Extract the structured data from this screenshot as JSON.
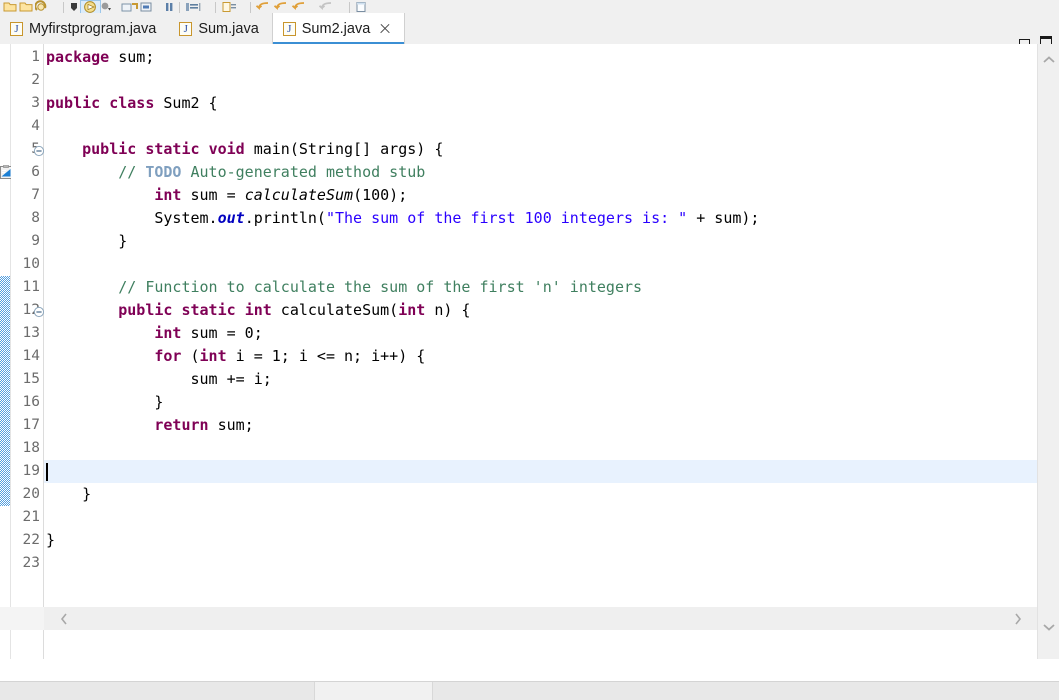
{
  "window": {
    "minimize_label": "Minimize",
    "maximize_label": "Maximize"
  },
  "toolbar": {
    "icons": [
      {
        "name": "new-java-project-icon",
        "glyph": "folder-yellow"
      },
      {
        "name": "new-folder-icon",
        "glyph": "folder-yellow"
      },
      {
        "name": "save-icon",
        "glyph": "save-disk"
      },
      {
        "name": "debug-icon",
        "glyph": "bug-black"
      },
      {
        "name": "run-icon",
        "glyph": "run-green-active",
        "active": true
      },
      {
        "name": "run-dropdown-icon",
        "glyph": "chevron-down"
      },
      {
        "name": "external-tools-icon",
        "glyph": "tools"
      },
      {
        "name": "new-class-icon",
        "glyph": "class-box"
      },
      {
        "name": "pause-icon",
        "glyph": "pause-bars"
      },
      {
        "name": "toggle-breakpoint-icon",
        "glyph": "breakpoint"
      },
      {
        "name": "open-type-icon",
        "glyph": "type-box"
      },
      {
        "name": "back-navigation-icon",
        "glyph": "arrow-back"
      },
      {
        "name": "forward-navigation-icon",
        "glyph": "arrow-forward"
      },
      {
        "name": "next-annotation-icon",
        "glyph": "arrow-next"
      },
      {
        "name": "previous-annotation-icon",
        "glyph": "arrow-prev"
      },
      {
        "name": "new-window-icon",
        "glyph": "window-box"
      }
    ]
  },
  "tabs": [
    {
      "label": "Myfirstprogram.java",
      "active": false,
      "closable": false
    },
    {
      "label": "Sum.java",
      "active": false,
      "closable": false
    },
    {
      "label": "Sum2.java",
      "active": true,
      "closable": true
    }
  ],
  "editor": {
    "active_file": "Sum2.java",
    "current_line": 19,
    "first_line_number": 1,
    "last_line_number": 23,
    "change_bar_start_line": 11,
    "change_bar_end_line": 20,
    "todo_marker_line": 6,
    "fold_marker_lines": [
      5,
      12
    ],
    "colors": {
      "keyword": "#7f0055",
      "string": "#2a00ff",
      "comment": "#3f7f5f",
      "todo_tag": "#7f9fbf",
      "static_field": "#0000c0",
      "line_number": "#6c6c6c",
      "current_line_highlight": "#e8f2fe",
      "tab_active_underline": "#3b8fd4",
      "change_bar": "#1a7fd4"
    },
    "lines": [
      {
        "n": 1,
        "tokens": [
          {
            "t": "package",
            "c": "kw"
          },
          {
            "t": " sum;",
            "c": "plain"
          }
        ]
      },
      {
        "n": 2,
        "tokens": []
      },
      {
        "n": 3,
        "tokens": [
          {
            "t": "public",
            "c": "kw"
          },
          {
            "t": " ",
            "c": "plain"
          },
          {
            "t": "class",
            "c": "kw"
          },
          {
            "t": " Sum2 {",
            "c": "plain"
          }
        ]
      },
      {
        "n": 4,
        "tokens": []
      },
      {
        "n": 5,
        "tokens": [
          {
            "t": "    ",
            "c": "plain"
          },
          {
            "t": "public",
            "c": "kw"
          },
          {
            "t": " ",
            "c": "plain"
          },
          {
            "t": "static",
            "c": "kw"
          },
          {
            "t": " ",
            "c": "plain"
          },
          {
            "t": "void",
            "c": "kw"
          },
          {
            "t": " main(String[] args) {",
            "c": "plain"
          }
        ]
      },
      {
        "n": 6,
        "tokens": [
          {
            "t": "        ",
            "c": "plain"
          },
          {
            "t": "// ",
            "c": "cmt"
          },
          {
            "t": "TODO",
            "c": "todo"
          },
          {
            "t": " Auto-generated method stub",
            "c": "cmt"
          }
        ]
      },
      {
        "n": 7,
        "tokens": [
          {
            "t": "            ",
            "c": "plain"
          },
          {
            "t": "int",
            "c": "kw"
          },
          {
            "t": " sum = ",
            "c": "plain"
          },
          {
            "t": "calculateSum",
            "c": "mth-static"
          },
          {
            "t": "(100);",
            "c": "plain"
          }
        ]
      },
      {
        "n": 8,
        "tokens": [
          {
            "t": "            System.",
            "c": "plain"
          },
          {
            "t": "out",
            "c": "stat"
          },
          {
            "t": ".println(",
            "c": "plain"
          },
          {
            "t": "\"The sum of the first 100 integers is: \"",
            "c": "str"
          },
          {
            "t": " + sum);",
            "c": "plain"
          }
        ]
      },
      {
        "n": 9,
        "tokens": [
          {
            "t": "        }",
            "c": "plain"
          }
        ]
      },
      {
        "n": 10,
        "tokens": []
      },
      {
        "n": 11,
        "tokens": [
          {
            "t": "        ",
            "c": "plain"
          },
          {
            "t": "// Function to calculate the sum of the first 'n' integers",
            "c": "cmt"
          }
        ]
      },
      {
        "n": 12,
        "tokens": [
          {
            "t": "        ",
            "c": "plain"
          },
          {
            "t": "public",
            "c": "kw"
          },
          {
            "t": " ",
            "c": "plain"
          },
          {
            "t": "static",
            "c": "kw"
          },
          {
            "t": " ",
            "c": "plain"
          },
          {
            "t": "int",
            "c": "kw"
          },
          {
            "t": " calculateSum(",
            "c": "plain"
          },
          {
            "t": "int",
            "c": "kw"
          },
          {
            "t": " n) {",
            "c": "plain"
          }
        ]
      },
      {
        "n": 13,
        "tokens": [
          {
            "t": "            ",
            "c": "plain"
          },
          {
            "t": "int",
            "c": "kw"
          },
          {
            "t": " sum = 0;",
            "c": "plain"
          }
        ]
      },
      {
        "n": 14,
        "tokens": [
          {
            "t": "            ",
            "c": "plain"
          },
          {
            "t": "for",
            "c": "kw"
          },
          {
            "t": " (",
            "c": "plain"
          },
          {
            "t": "int",
            "c": "kw"
          },
          {
            "t": " i = 1; i <= n; i++) {",
            "c": "plain"
          }
        ]
      },
      {
        "n": 15,
        "tokens": [
          {
            "t": "                sum += i;",
            "c": "plain"
          }
        ]
      },
      {
        "n": 16,
        "tokens": [
          {
            "t": "            }",
            "c": "plain"
          }
        ]
      },
      {
        "n": 17,
        "tokens": [
          {
            "t": "            ",
            "c": "plain"
          },
          {
            "t": "return",
            "c": "kw"
          },
          {
            "t": " sum;",
            "c": "plain"
          }
        ]
      },
      {
        "n": 18,
        "tokens": []
      },
      {
        "n": 19,
        "tokens": []
      },
      {
        "n": 20,
        "tokens": [
          {
            "t": "    }",
            "c": "plain"
          }
        ]
      },
      {
        "n": 21,
        "tokens": []
      },
      {
        "n": 22,
        "tokens": [
          {
            "t": "}",
            "c": "plain"
          }
        ]
      },
      {
        "n": 23,
        "tokens": []
      }
    ]
  },
  "scrollbars": {
    "vertical": {
      "up_icon": "chevron-up-icon",
      "down_icon": "chevron-down-icon"
    },
    "horizontal": {
      "left_icon": "chevron-left-icon",
      "right_icon": "chevron-right-icon"
    }
  },
  "statusbar": {
    "cells": [
      "",
      "",
      ""
    ]
  }
}
